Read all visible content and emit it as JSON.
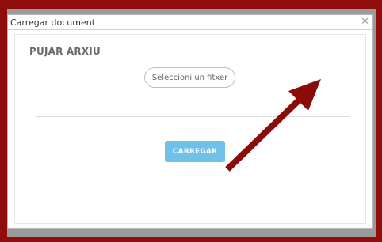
{
  "dialog": {
    "title": "Carregar document",
    "close_icon": "close-icon"
  },
  "content": {
    "heading": "PUJAR ARXIU",
    "select_file_label": "Seleccioni un fitxer",
    "upload_button_label": "CARREGAR"
  },
  "colors": {
    "frame_border": "#8f0d0d",
    "upload_button": "#6fc1ea",
    "annotation_arrow": "#8b0b0b"
  }
}
